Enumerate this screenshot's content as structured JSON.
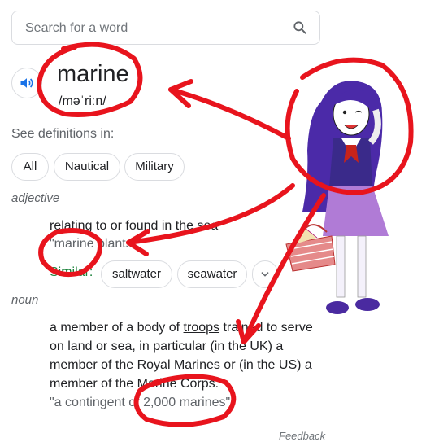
{
  "search": {
    "placeholder": "Search for a word"
  },
  "entry": {
    "word": "marine",
    "phonetic": "/məˈriːn/"
  },
  "definitions_in": {
    "label": "See definitions in:",
    "chips": [
      "All",
      "Nautical",
      "Military"
    ]
  },
  "senses": {
    "adjective": {
      "pos": "adjective",
      "definition": "relating to or found in the sea",
      "example": "\"marine plants\"",
      "similar_label": "Similar:",
      "similar": [
        "saltwater",
        "seawater"
      ]
    },
    "noun": {
      "pos": "noun",
      "definition_lines": [
        "a member of a body of",
        "troops",
        "trained to serve",
        "on land or sea, in particular (in the UK) a",
        "member of the Royal Marines or (in the US) a",
        "member of the Marine Corps."
      ],
      "example": "\"a contingent of 2,000 marines\""
    }
  },
  "footer": {
    "feedback": "Feedback"
  },
  "icons": {
    "search": "search-icon",
    "speaker": "speaker-icon",
    "expand": "chevron-down-icon"
  },
  "colors": {
    "speaker_blue": "#1a73e8",
    "similar_green": "#188038",
    "annotation_red": "#e8141d",
    "hair_purple": "#4b2aa8",
    "skirt_purple": "#b07bd6",
    "basket_red": "#d9534f"
  }
}
